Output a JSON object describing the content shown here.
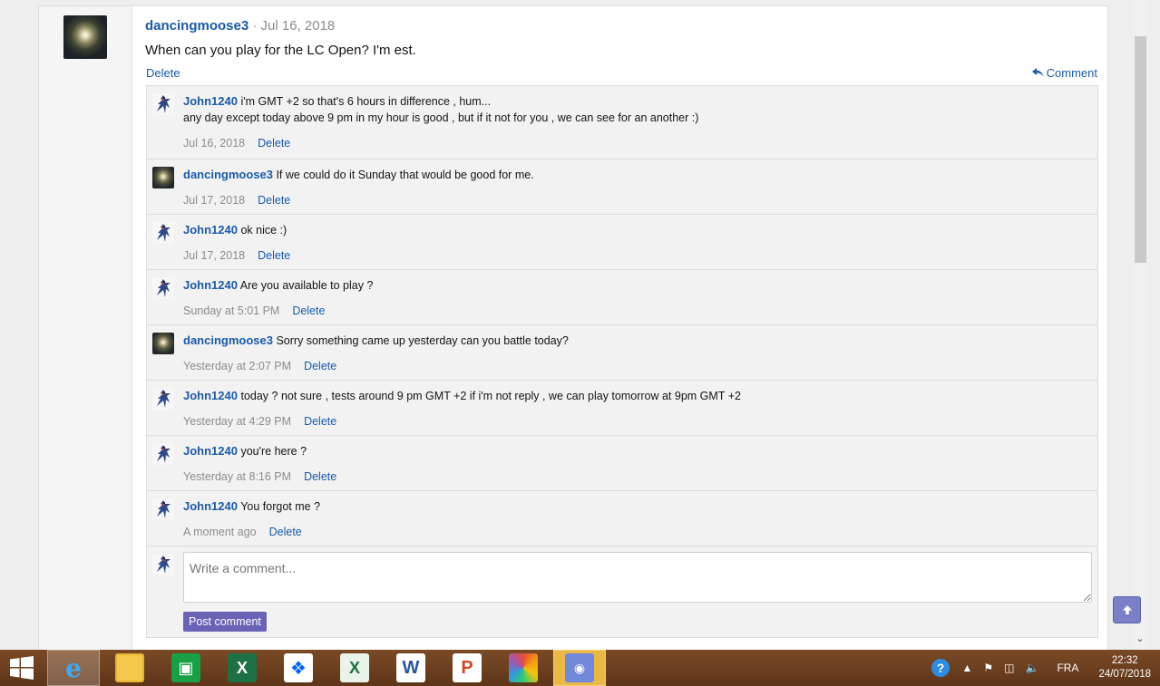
{
  "post": {
    "author": "dancingmoose3",
    "separator": "·",
    "date": "Jul 16, 2018",
    "body": "When can you play for the LC Open? I'm est.",
    "delete_label": "Delete",
    "comment_label": "Comment"
  },
  "comments": [
    {
      "author": "John1240",
      "avatar": "john",
      "lines": [
        "i'm GMT +2 so that's 6 hours in difference , hum...",
        "any day except today above 9 pm in my hour is good , but if it not for you , we can see for an another :)"
      ],
      "date": "Jul 16, 2018",
      "delete": "Delete"
    },
    {
      "author": "dancingmoose3",
      "avatar": "moose",
      "lines": [
        "If we could do it Sunday that would be good for me."
      ],
      "date": "Jul 17, 2018",
      "delete": "Delete"
    },
    {
      "author": "John1240",
      "avatar": "john",
      "lines": [
        "ok nice :)"
      ],
      "date": "Jul 17, 2018",
      "delete": "Delete"
    },
    {
      "author": "John1240",
      "avatar": "john",
      "lines": [
        "Are you available to play ?"
      ],
      "date": "Sunday at 5:01 PM",
      "delete": "Delete"
    },
    {
      "author": "dancingmoose3",
      "avatar": "moose",
      "lines": [
        "Sorry something came up yesterday can you battle today?"
      ],
      "date": "Yesterday at 2:07 PM",
      "delete": "Delete"
    },
    {
      "author": "John1240",
      "avatar": "john",
      "lines": [
        "today ? not sure , tests around 9 pm GMT +2 if i'm not reply , we can play tomorrow at 9pm GMT +2"
      ],
      "date": "Yesterday at 4:29 PM",
      "delete": "Delete"
    },
    {
      "author": "John1240",
      "avatar": "john",
      "lines": [
        "you're here ?"
      ],
      "date": "Yesterday at 8:16 PM",
      "delete": "Delete"
    },
    {
      "author": "John1240",
      "avatar": "john",
      "lines": [
        "You forgot me ?"
      ],
      "date": "A moment ago",
      "delete": "Delete"
    }
  ],
  "reply": {
    "placeholder": "Write a comment...",
    "button": "Post comment"
  },
  "taskbar": {
    "apps": [
      "start",
      "internet-explorer",
      "file-explorer",
      "store",
      "excel",
      "dropbox",
      "excel-alt",
      "word",
      "powerpoint",
      "photos",
      "discord"
    ],
    "language": "FRA",
    "time": "22:32",
    "date": "24/07/2018"
  },
  "colors": {
    "link": "#1a5aa9",
    "button": "#6a63b5",
    "taskbar": "#6c3e1e"
  }
}
